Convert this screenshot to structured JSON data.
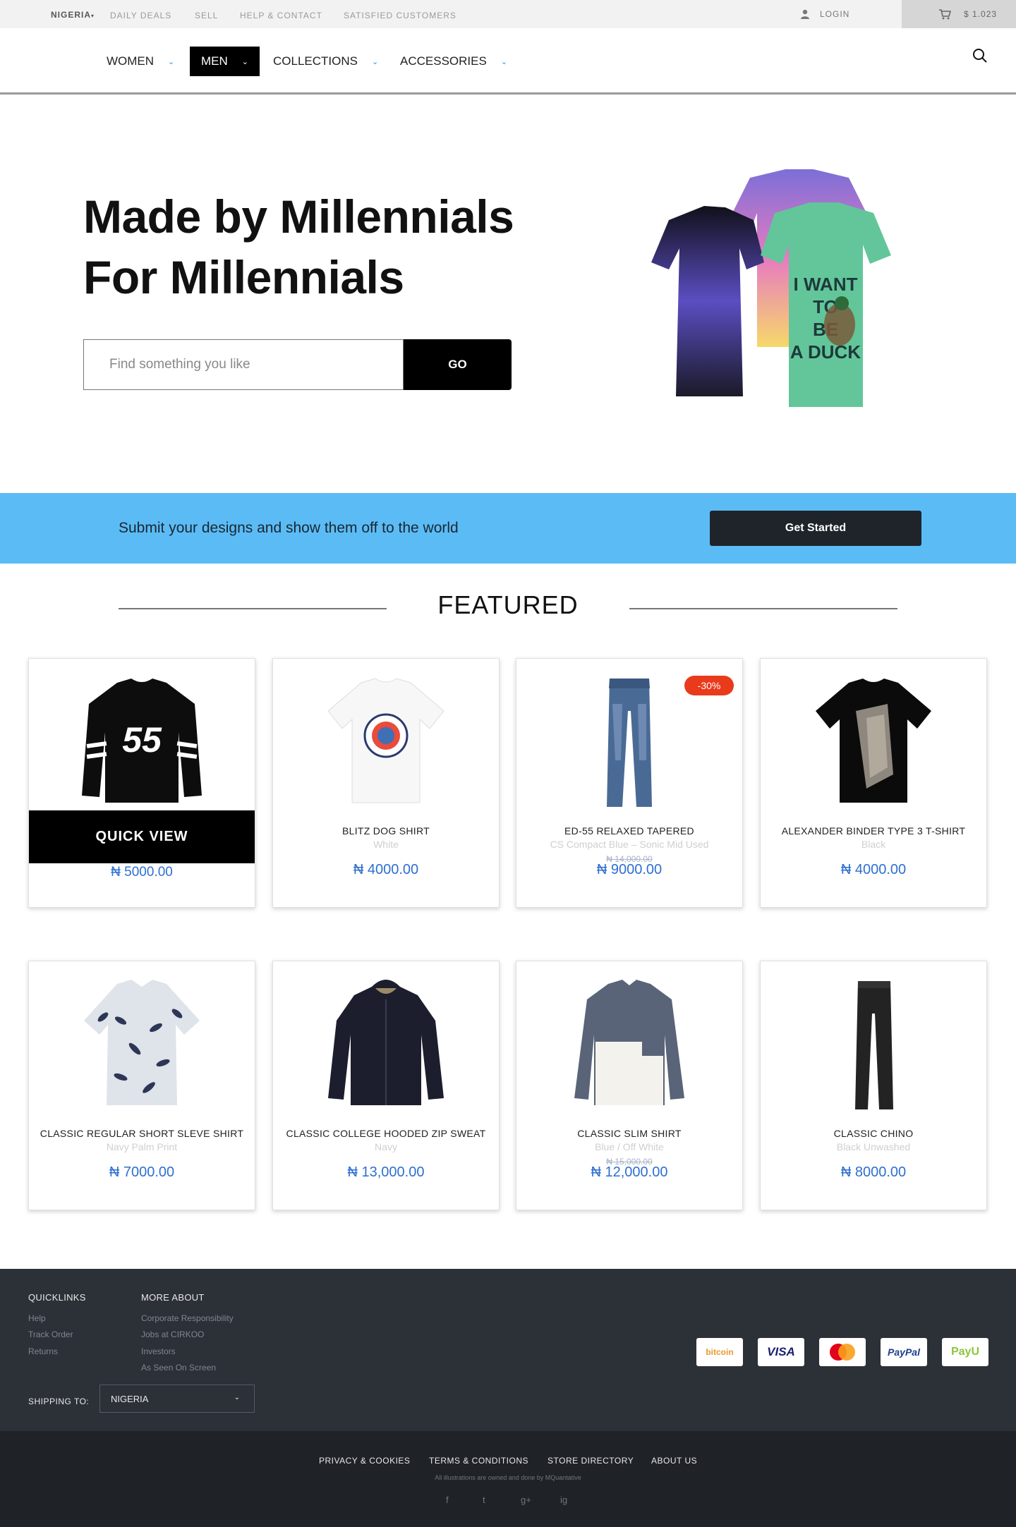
{
  "topbar": {
    "country": "NIGERIA",
    "links": [
      "DAILY DEALS",
      "SELL",
      "HELP & CONTACT",
      "SATISFIED CUSTOMERS"
    ],
    "login": "LOGIN",
    "cart_total": "$ 1.023"
  },
  "nav": {
    "items": [
      {
        "label": "WOMEN",
        "active": false
      },
      {
        "label": "MEN",
        "active": true
      },
      {
        "label": "COLLECTIONS",
        "active": false
      },
      {
        "label": "ACCESSORIES",
        "active": false
      }
    ]
  },
  "hero": {
    "line1": "Made by Millennials",
    "line2": "For Millennials",
    "search_placeholder": "Find something you like",
    "go_label": "GO"
  },
  "banner": {
    "text": "Submit your designs and show them off to the world",
    "button": "Get Started"
  },
  "featured": {
    "title": "FEATURED",
    "quick_view": "QUICK VIEW",
    "products": [
      {
        "name": "",
        "color": "",
        "old_price": "",
        "price": "₦ 5000.00",
        "badge": "",
        "image": "jersey-55"
      },
      {
        "name": "BLITZ DOG SHIRT",
        "color": "White",
        "old_price": "",
        "price": "₦ 4000.00",
        "badge": "",
        "image": "white-tee"
      },
      {
        "name": "ED-55 RELAXED TAPERED",
        "color": "CS Compact Blue – Sonic Mid Used",
        "old_price": "₦ 14,000.00",
        "price": "₦ 9000.00",
        "badge": "-30%",
        "image": "blue-jeans"
      },
      {
        "name": "ALEXANDER BINDER TYPE 3 T-SHIRT",
        "color": "Black",
        "old_price": "",
        "price": "₦ 4000.00",
        "badge": "",
        "image": "black-tee"
      },
      {
        "name": "CLASSIC REGULAR SHORT SLEVE SHIRT",
        "color": "Navy Palm Print",
        "old_price": "",
        "price": "₦ 7000.00",
        "badge": "",
        "image": "print-shirt"
      },
      {
        "name": "CLASSIC COLLEGE HOODED ZIP SWEAT",
        "color": "Navy",
        "old_price": "",
        "price": "₦ 13,000.00",
        "badge": "",
        "image": "hoodie"
      },
      {
        "name": "CLASSIC SLIM SHIRT",
        "color": "Blue / Off White",
        "old_price": "₦ 15,000.00",
        "price": "₦ 12,000.00",
        "badge": "",
        "image": "slim-shirt"
      },
      {
        "name": "CLASSIC CHINO",
        "color": "Black Unwashed",
        "old_price": "",
        "price": "₦ 8000.00",
        "badge": "",
        "image": "chino"
      }
    ]
  },
  "footer": {
    "quicklinks_title": "QUICKLINKS",
    "quicklinks": [
      "Help",
      "Track Order",
      "Returns"
    ],
    "more_title": "MORE ABOUT",
    "more_links": [
      "Corporate Responsibility",
      "Jobs at CIRKOO",
      "Investors",
      "As Seen On Screen"
    ],
    "shipping_label": "SHIPPING TO:",
    "shipping_value": "NIGERIA",
    "payments": [
      "bitcoin",
      "VISA",
      "MasterCard",
      "PayPal",
      "PayU"
    ],
    "bottom_links": [
      "PRIVACY & COOKIES",
      "TERMS & CONDITIONS",
      "STORE DIRECTORY",
      "ABOUT US"
    ],
    "note": "All illustrations are owned and done by MQuantative",
    "social": [
      "f",
      "t",
      "g+",
      "ig"
    ]
  },
  "colors": {
    "banner": "#5bbcf5",
    "price": "#2e6fd1",
    "badge": "#ea3a1c",
    "footer": "#2c3037",
    "bottombar": "#1f2227"
  }
}
